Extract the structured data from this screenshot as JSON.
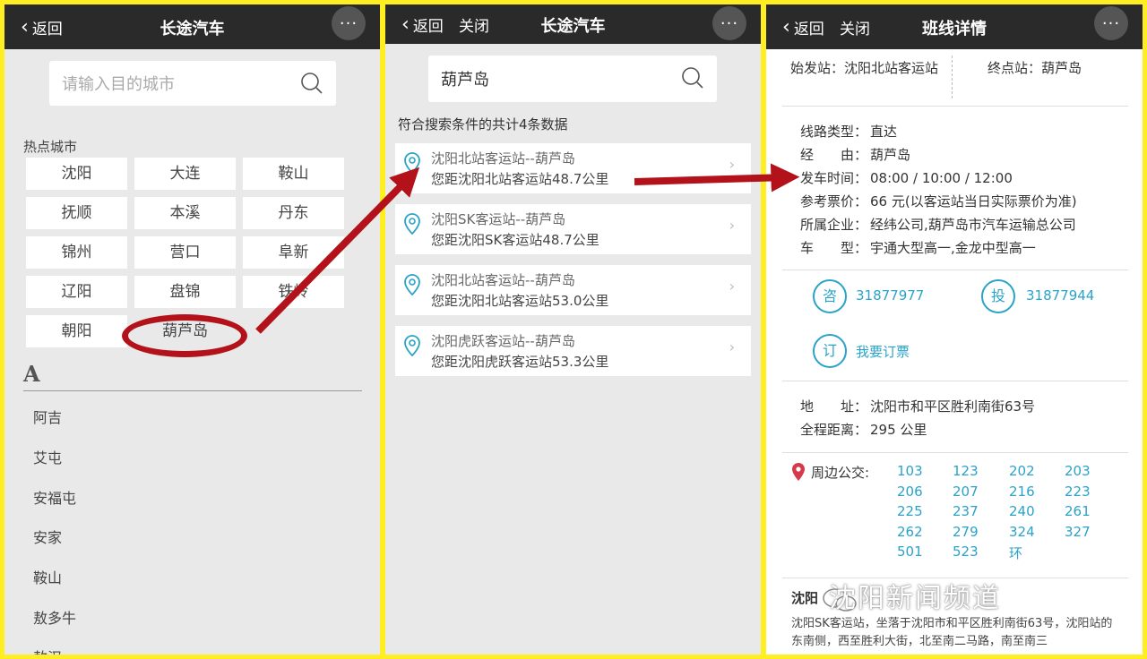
{
  "panel1": {
    "back": "返回",
    "title": "长途汽车",
    "more": "···",
    "search_placeholder": "请输入目的城市",
    "hot_title": "热点城市",
    "cities": [
      "沈阳",
      "大连",
      "鞍山",
      "抚顺",
      "本溪",
      "丹东",
      "锦州",
      "营口",
      "阜新",
      "辽阳",
      "盘锦",
      "铁岭",
      "朝阳",
      "葫芦岛"
    ],
    "alpha_header": "A",
    "a_list": [
      "阿吉",
      "艾屯",
      "安福屯",
      "安家",
      "鞍山",
      "敖多牛",
      "敖汉"
    ]
  },
  "panel2": {
    "back": "返回",
    "close": "关闭",
    "title": "长途汽车",
    "more": "···",
    "search_value": "葫芦岛",
    "count_text": "符合搜索条件的共计4条数据",
    "results": [
      {
        "route": "沈阳北站客运站--葫芦岛",
        "distance": "您距沈阳北站客运站48.7公里"
      },
      {
        "route": "沈阳SK客运站--葫芦岛",
        "distance": "您距沈阳SK客运站48.7公里"
      },
      {
        "route": "沈阳北站客运站--葫芦岛",
        "distance": "您距沈阳北站客运站53.0公里"
      },
      {
        "route": "沈阳虎跃客运站--葫芦岛",
        "distance": "您距沈阳虎跃客运站53.3公里"
      }
    ]
  },
  "panel3": {
    "back": "返回",
    "close": "关闭",
    "title": "班线详情",
    "more": "···",
    "start": "始发站：沈阳北站客运站",
    "end": "终点站：葫芦岛",
    "info": [
      {
        "label": "线路类型：",
        "value": "直达"
      },
      {
        "label": "经　　由：",
        "value": "葫芦岛"
      },
      {
        "label": "发车时间：",
        "value": "08:00 / 10:00 / 12:00"
      },
      {
        "label": "参考票价：",
        "value": "66 元(以客运站当日实际票价为准)"
      },
      {
        "label": "所属企业：",
        "value": "经纬公司,葫芦岛市汽车运输总公司"
      },
      {
        "label": "车　　型：",
        "value": "宇通大型高一,金龙中型高一"
      }
    ],
    "consult_icon": "咨",
    "consult_phone": "31877977",
    "complain_icon": "投",
    "complain_phone": "31877944",
    "book_icon": "订",
    "book_text": "我要订票",
    "address": {
      "label": "地　　址：",
      "value": "沈阳市和平区胜利南街63号"
    },
    "distance": {
      "label": "全程距离：",
      "value": "295 公里"
    },
    "bus_label": "周边公交:",
    "buses": [
      "103",
      "123",
      "202",
      "203",
      "206",
      "207",
      "216",
      "223",
      "225",
      "237",
      "240",
      "261",
      "262",
      "279",
      "324",
      "327",
      "501",
      "523",
      "环"
    ],
    "desc_title": "沈阳",
    "desc": "沈阳SK客运站，坐落于沈阳市和平区胜利南街63号，沈阳站的东南侧，西至胜利大街，北至南二马路，南至南三",
    "watermark": "沈阳新闻频道"
  },
  "colors": {
    "accent": "#2aa3c9",
    "annotation": "#b3121a",
    "border": "#ffee22",
    "topbar": "#2a2a2a"
  }
}
